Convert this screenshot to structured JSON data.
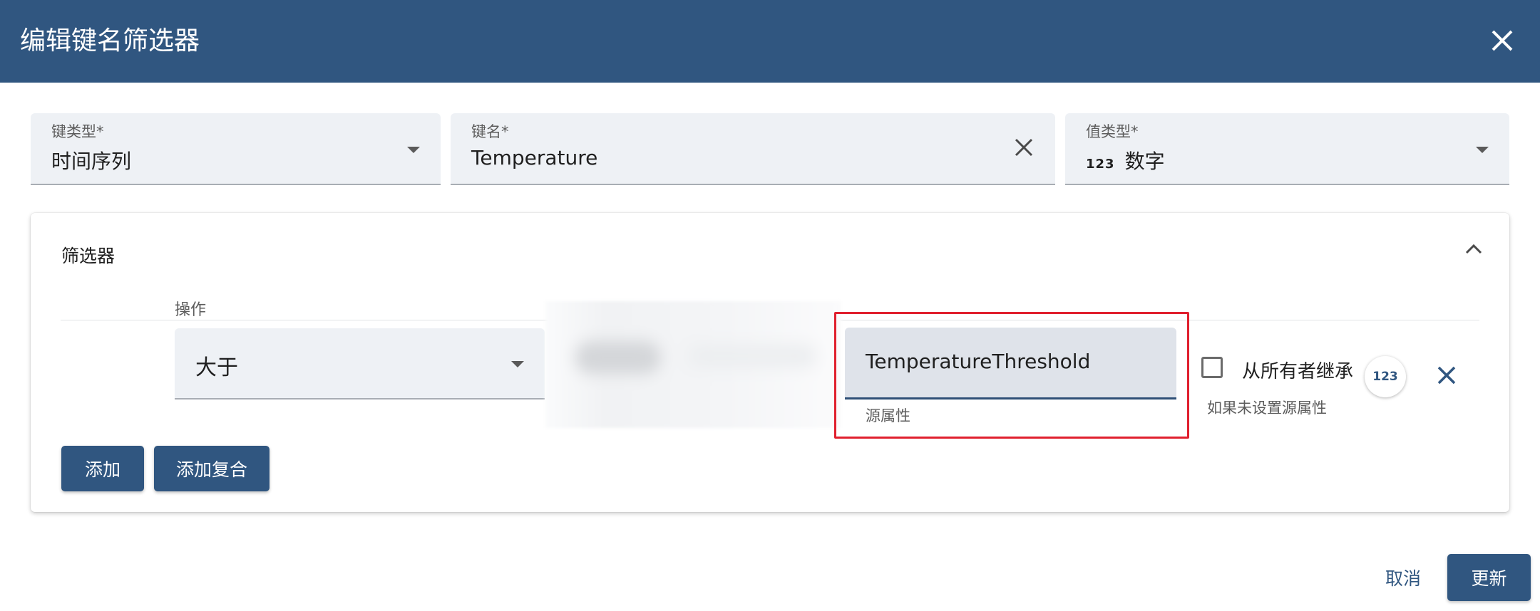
{
  "dialog": {
    "title": "编辑键名筛选器",
    "close_icon": "close-icon"
  },
  "key_type": {
    "label": "键类型*",
    "value": "时间序列"
  },
  "key_name": {
    "label": "键名*",
    "value": "Temperature"
  },
  "value_type": {
    "label": "值类型*",
    "icon_text": "123",
    "value": "数字"
  },
  "filters": {
    "title": "筛选器",
    "operation_header": "操作",
    "operation_value": "大于",
    "source_attribute_value": "TemperatureThreshold",
    "source_attribute_hint": "源属性",
    "inherit_label": "从所有者继承",
    "inherit_hint": "如果未设置源属性",
    "type_badge": "123"
  },
  "buttons": {
    "add": "添加",
    "add_complex": "添加复合",
    "cancel": "取消",
    "update": "更新"
  },
  "colors": {
    "header": "#305680",
    "highlight": "#e0202e"
  }
}
